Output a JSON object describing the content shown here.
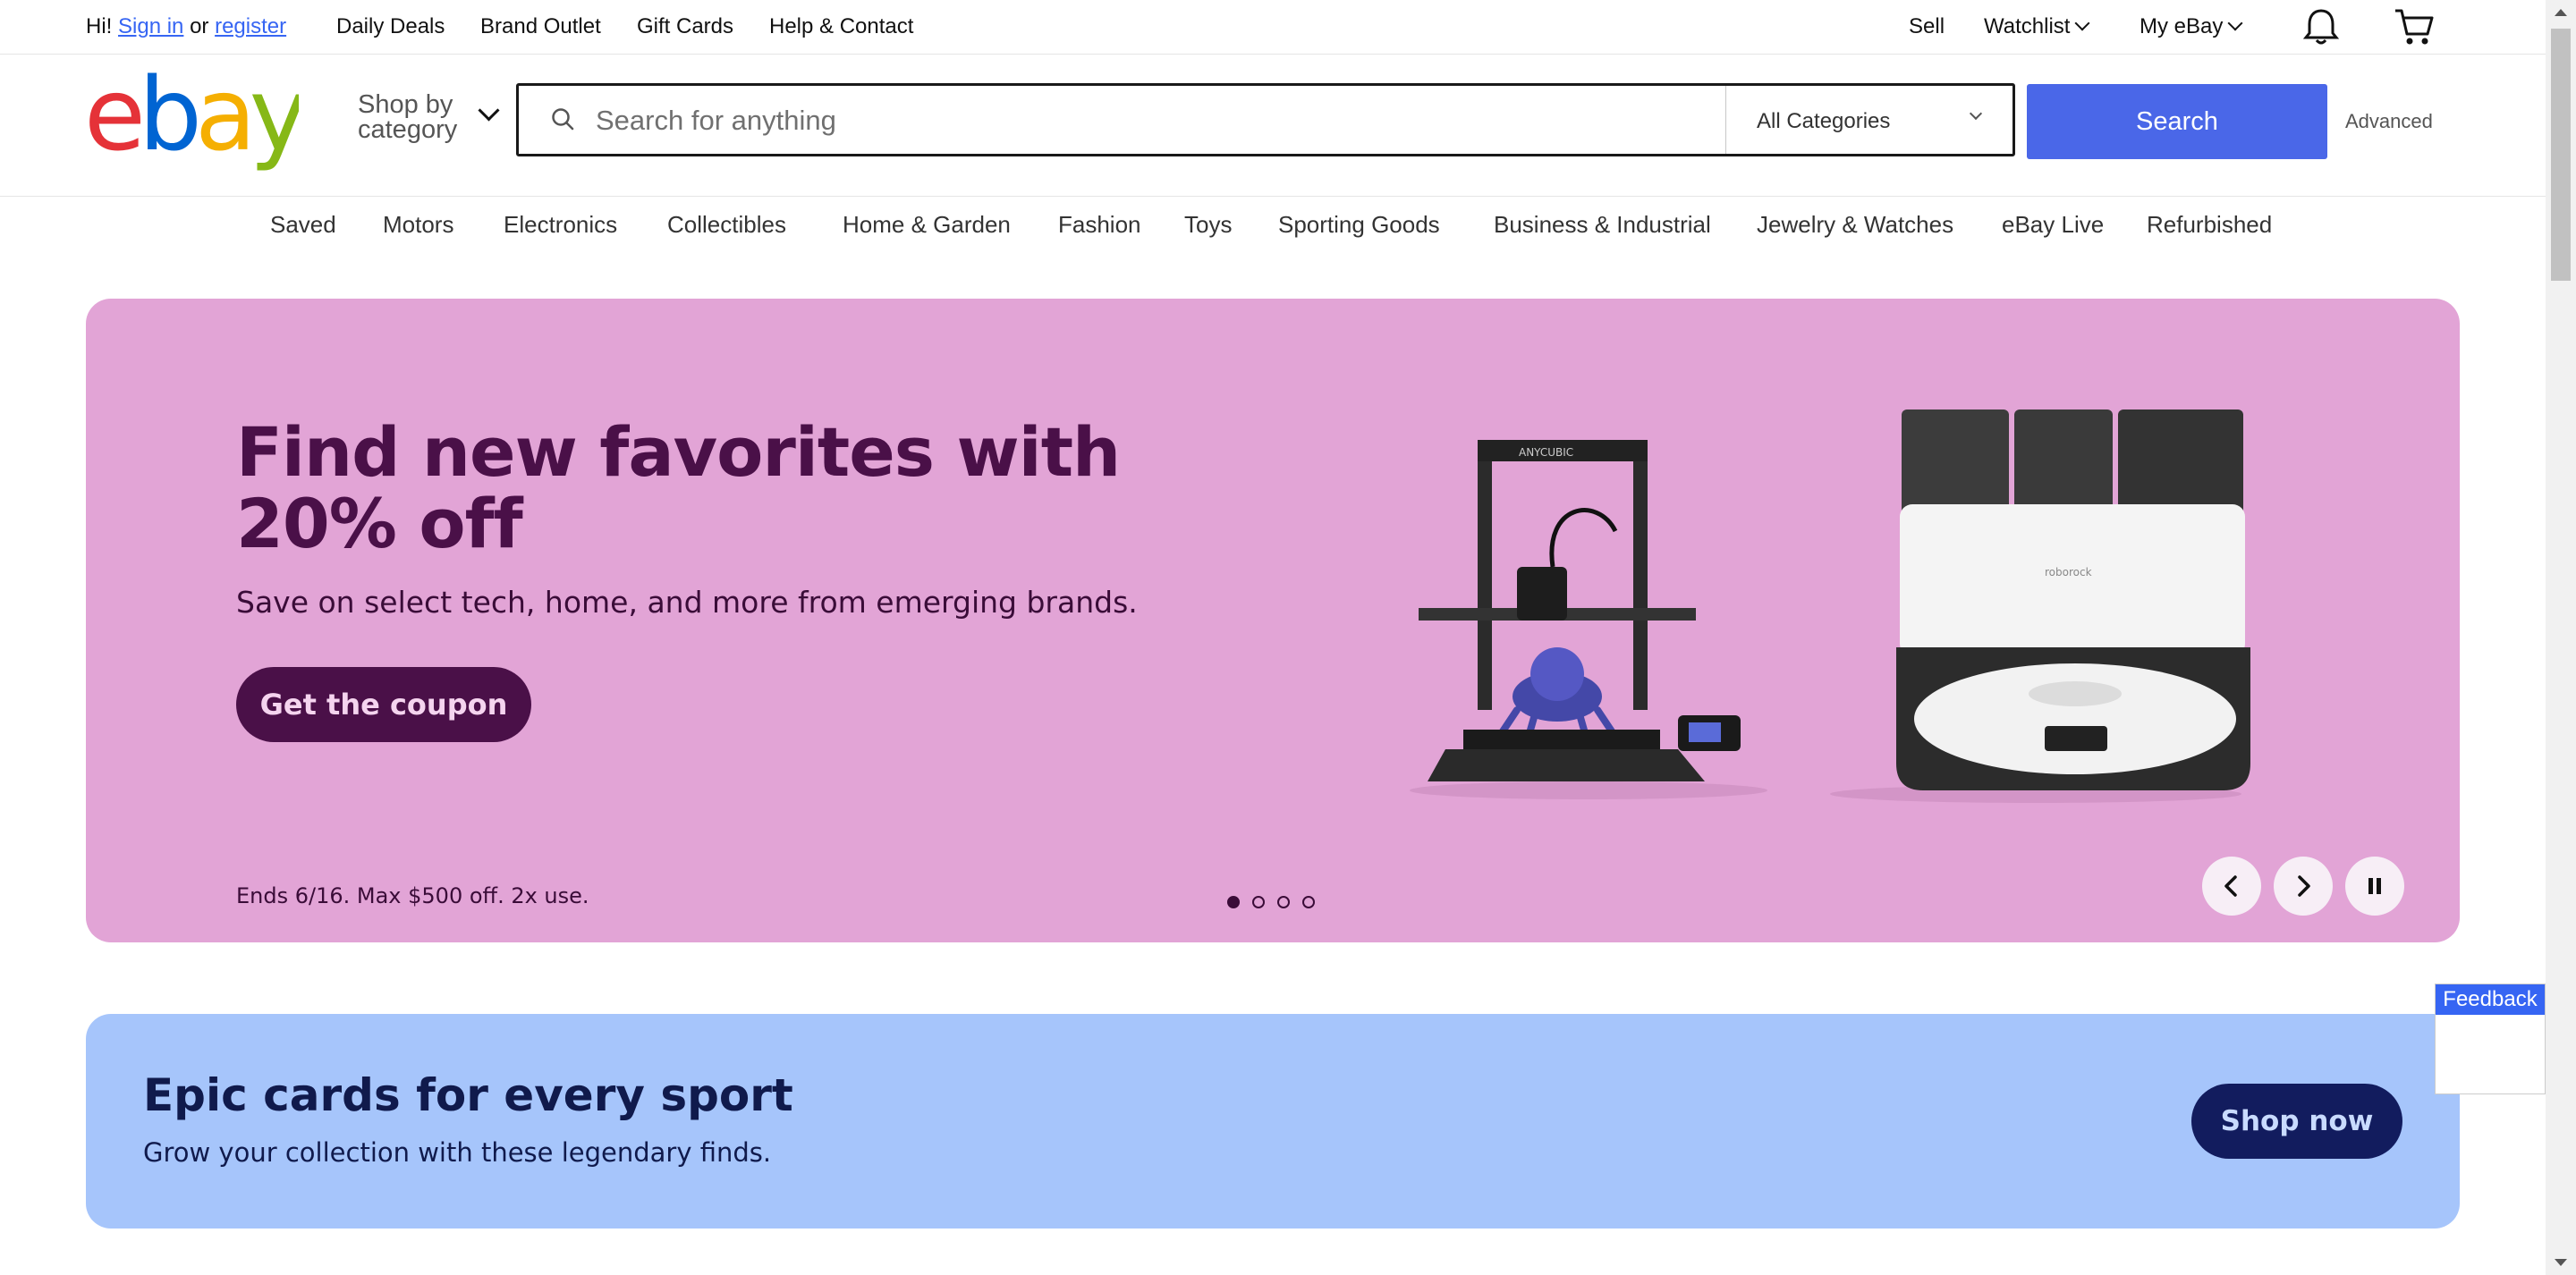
{
  "topbar": {
    "greeting": "Hi!",
    "sign_in": "Sign in",
    "or": "or",
    "register": "register",
    "links": [
      "Daily Deals",
      "Brand Outlet",
      "Gift Cards",
      "Help & Contact"
    ],
    "sell": "Sell",
    "watchlist": "Watchlist",
    "my_ebay": "My eBay",
    "notification_icon": "bell-icon",
    "cart_icon": "cart-icon"
  },
  "header": {
    "logo_text": "ebay",
    "logo_colors": [
      "#e53238",
      "#0064d2",
      "#f5af02",
      "#86b817"
    ],
    "shop_by_line1": "Shop by",
    "shop_by_line2": "category",
    "search": {
      "placeholder": "Search for anything",
      "value": ""
    },
    "category_select": "All Categories",
    "search_button": "Search",
    "advanced": "Advanced",
    "accent_color": "#3665f3"
  },
  "category_nav": [
    "Saved",
    "Motors",
    "Electronics",
    "Collectibles",
    "Home & Garden",
    "Fashion",
    "Toys",
    "Sporting Goods",
    "Business & Industrial",
    "Jewelry & Watches",
    "eBay Live",
    "Refurbished"
  ],
  "hero": {
    "title": "Find new favorites with 20% off",
    "subtitle": "Save on select tech, home, and more from emerging brands.",
    "cta": "Get the coupon",
    "fine_print": "Ends 6/16. Max $500 off. 2x use.",
    "background": "#e2a4d6",
    "slide_count": 4,
    "active_slide": 1,
    "product_1_brand": "ANYCUBIC",
    "product_2_brand": "roborock",
    "prev_icon": "chevron-left-icon",
    "next_icon": "chevron-right-icon",
    "pause_icon": "pause-icon"
  },
  "banner2": {
    "title": "Epic cards for every sport",
    "subtitle": "Grow your collection with these legendary finds.",
    "cta": "Shop now",
    "background": "#a6c5fb"
  },
  "feedback": {
    "label": "Feedback"
  }
}
